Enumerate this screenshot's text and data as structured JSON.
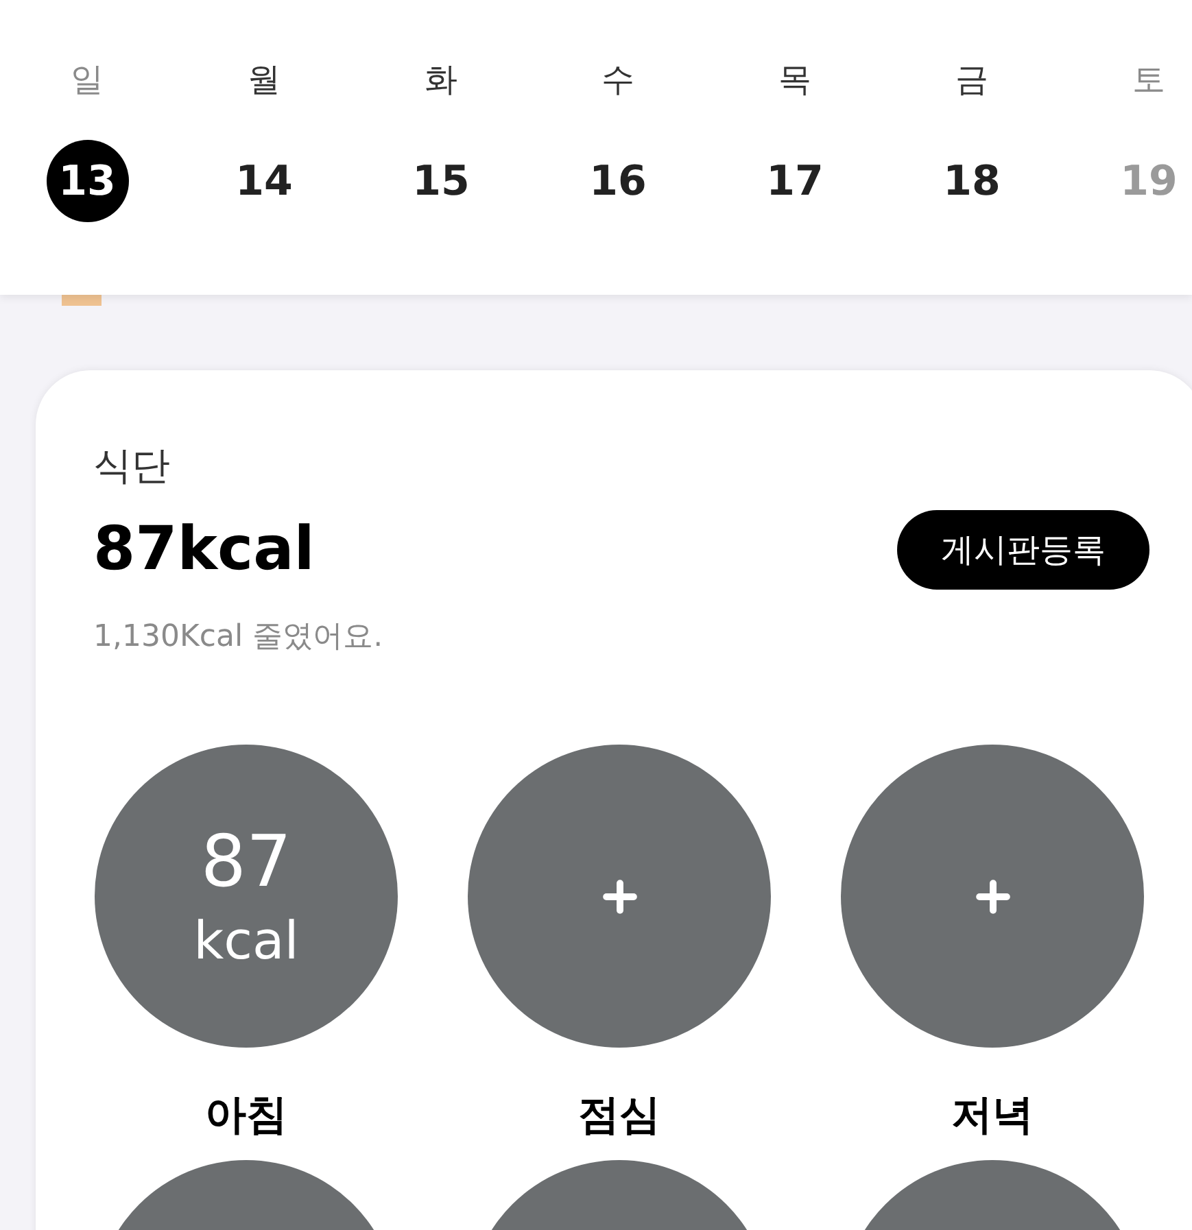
{
  "week": {
    "days": [
      {
        "label": "일",
        "muted": true
      },
      {
        "label": "월",
        "muted": false
      },
      {
        "label": "화",
        "muted": false
      },
      {
        "label": "수",
        "muted": false
      },
      {
        "label": "목",
        "muted": false
      },
      {
        "label": "금",
        "muted": false
      },
      {
        "label": "토",
        "muted": true
      }
    ],
    "dates": [
      {
        "label": "13",
        "selected": true,
        "muted": false
      },
      {
        "label": "14",
        "selected": false,
        "muted": false
      },
      {
        "label": "15",
        "selected": false,
        "muted": false
      },
      {
        "label": "16",
        "selected": false,
        "muted": false
      },
      {
        "label": "17",
        "selected": false,
        "muted": false
      },
      {
        "label": "18",
        "selected": false,
        "muted": false
      },
      {
        "label": "19",
        "selected": false,
        "muted": true
      }
    ]
  },
  "diet": {
    "title": "식단",
    "total": "87kcal",
    "post_button": "게시판등록",
    "note": "1,130Kcal 줄였어요.",
    "meals": [
      {
        "kind": "calories",
        "value": "87",
        "unit": "kcal",
        "label": "아침"
      },
      {
        "kind": "empty",
        "label": "점심"
      },
      {
        "kind": "empty",
        "label": "저녁"
      }
    ]
  }
}
